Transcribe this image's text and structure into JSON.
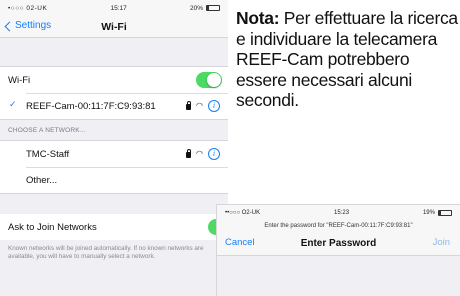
{
  "wifi_screen": {
    "status": {
      "carrier": "•○○○ 02-UK",
      "time": "15:17",
      "battery": "20%",
      "battery_level": 0.2
    },
    "nav": {
      "back_label": "Settings",
      "title": "Wi-Fi"
    },
    "wifi_row": {
      "label": "Wi-Fi",
      "enabled": true
    },
    "connected": {
      "name": "REEF-Cam-00:11:7F:C9:93:81"
    },
    "section_header": "CHOOSE A NETWORK...",
    "networks": [
      {
        "name": "TMC-Staff"
      }
    ],
    "other_label": "Other...",
    "ask": {
      "label": "Ask to Join Networks",
      "description": "Known networks will be joined automatically. If no known networks are available, you will have to manually select a network."
    }
  },
  "password_screen": {
    "status": {
      "carrier": "••○○○ O2-UK",
      "time": "15:23",
      "battery": "19%",
      "battery_level": 0.19
    },
    "prompt": "Enter the password for \"REEF-Cam-00:11:7F:C9:93:81\"",
    "cancel_label": "Cancel",
    "title": "Enter Password",
    "join_label": "Join"
  },
  "note": {
    "label": "Nota:",
    "text": "Per effettuare la ricerca e individuare la telecamera REEF-Cam potrebbero essere necessari alcuni secondi."
  },
  "colors": {
    "accent": "#157efb",
    "toggle_on": "#4cd964"
  }
}
